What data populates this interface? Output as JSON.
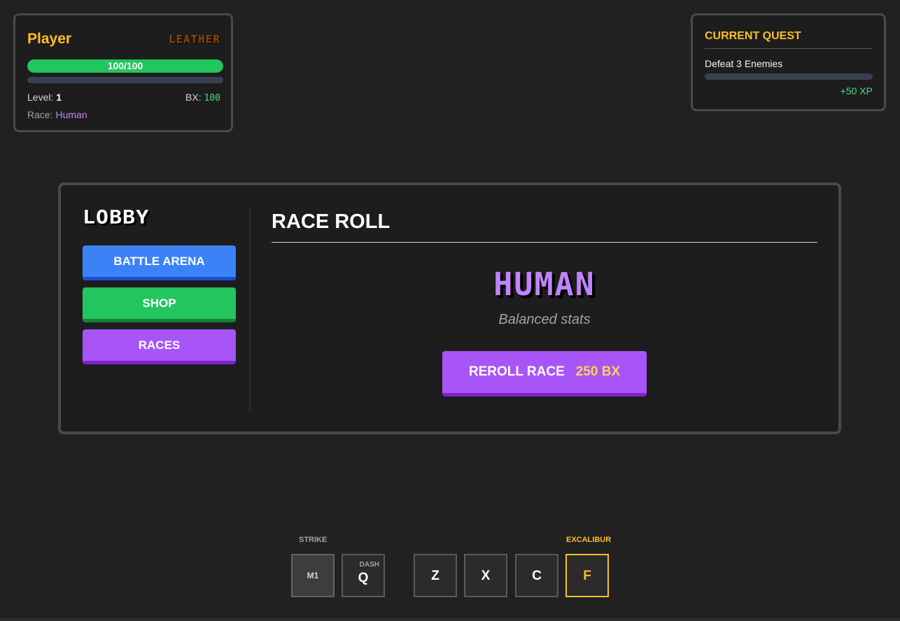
{
  "player": {
    "name": "Player",
    "armor": "LEATHER",
    "hp_text": "100/100",
    "hp_fraction": 1.0,
    "xp_fraction": 0.0,
    "level_label": "Level: ",
    "level_value": "1",
    "bx_label": "BX: ",
    "bx_value": "100",
    "race_label": "Race: ",
    "race_value": "Human"
  },
  "quest": {
    "title": "CURRENT QUEST",
    "description": "Defeat 3 Enemies",
    "progress_fraction": 0.0,
    "reward": "+50 XP"
  },
  "lobby": {
    "title": "LOBBY",
    "menu": {
      "battle_arena": "BATTLE ARENA",
      "shop": "SHOP",
      "races": "RACES"
    }
  },
  "race_roll": {
    "title": "RACE ROLL",
    "race_name": "HUMAN",
    "race_description": "Balanced stats",
    "reroll_label": "REROLL RACE",
    "reroll_cost": "250 BX"
  },
  "hotbar": {
    "strike_label": "STRIKE",
    "excalibur_label": "EXCALIBUR",
    "slots": {
      "m1": "M1",
      "q": "Q",
      "q_sub": "DASH",
      "z": "Z",
      "x": "X",
      "c": "C",
      "f": "F"
    }
  },
  "colors": {
    "background": "#212121",
    "gold": "#fbbf24",
    "hp_green": "#22c55e",
    "race_purple": "#c084fc",
    "battle_blue": "#3b82f6",
    "shop_green": "#22c55e",
    "races_purple": "#a855f7"
  }
}
